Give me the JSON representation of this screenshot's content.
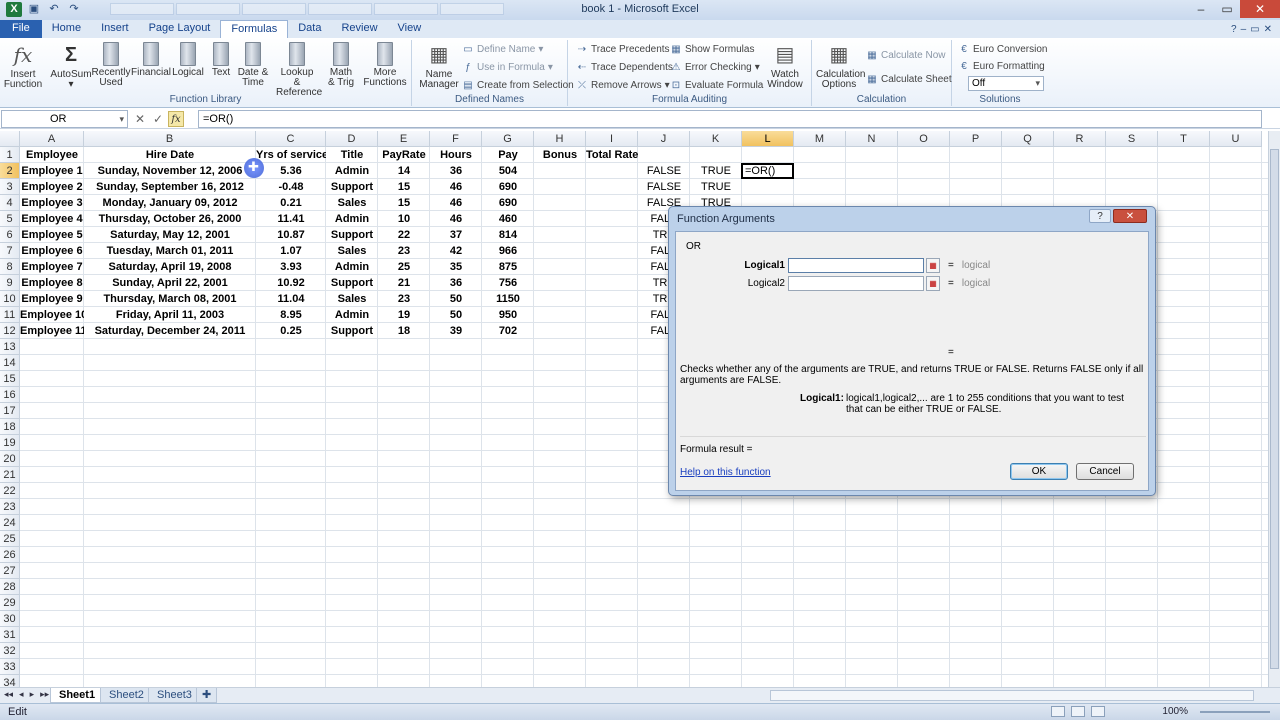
{
  "window": {
    "title": "book 1 - Microsoft Excel",
    "qat_icons": [
      "excel-logo-icon",
      "save-icon",
      "undo-icon",
      "redo-icon"
    ]
  },
  "ribbon_tabs": [
    "File",
    "Home",
    "Insert",
    "Page Layout",
    "Formulas",
    "Data",
    "Review",
    "View"
  ],
  "active_tab": "Formulas",
  "ribbon": {
    "function_library": {
      "label": "Function Library",
      "insert_function": "Insert Function",
      "insert_function_l1": "Insert",
      "insert_function_l2": "Function",
      "autosum": "AutoSum",
      "recently_used_l1": "Recently",
      "recently_used_l2": "Used",
      "financial": "Financial",
      "logical": "Logical",
      "text": "Text",
      "date_time_l1": "Date &",
      "date_time_l2": "Time",
      "lookup_l1": "Lookup &",
      "lookup_l2": "Reference",
      "math_l1": "Math",
      "math_l2": "& Trig",
      "more_l1": "More",
      "more_l2": "Functions"
    },
    "defined_names": {
      "label": "Defined Names",
      "name_manager_l1": "Name",
      "name_manager_l2": "Manager",
      "define_name": "Define Name",
      "use_in_formula": "Use in Formula",
      "create_from_selection": "Create from Selection"
    },
    "formula_auditing": {
      "label": "Formula Auditing",
      "trace_precedents": "Trace Precedents",
      "trace_dependents": "Trace Dependents",
      "remove_arrows": "Remove Arrows",
      "show_formulas": "Show Formulas",
      "error_checking": "Error Checking",
      "evaluate_formula": "Evaluate Formula",
      "watch_window_l1": "Watch",
      "watch_window_l2": "Window"
    },
    "calculation": {
      "label": "Calculation",
      "options_l1": "Calculation",
      "options_l2": "Options",
      "calc_now": "Calculate Now",
      "calc_sheet": "Calculate Sheet"
    },
    "solutions": {
      "label": "Solutions",
      "euro_conversion": "Euro Conversion",
      "euro_formatting": "Euro Formatting",
      "off": "Off"
    }
  },
  "formula_bar": {
    "name_box": "OR",
    "formula": "=OR()"
  },
  "columns": [
    "A",
    "B",
    "C",
    "D",
    "E",
    "F",
    "G",
    "H",
    "I",
    "J",
    "K",
    "L",
    "M",
    "N",
    "O",
    "P",
    "Q",
    "R",
    "S",
    "T",
    "U"
  ],
  "selected_column": "L",
  "selected_row": 2,
  "headers": [
    "Employee",
    "Hire Date",
    "Yrs of service",
    "Title",
    "PayRate",
    "Hours",
    "Pay",
    "Bonus",
    "Total Rate"
  ],
  "rows": [
    [
      "Employee 1",
      "Sunday, November 12, 2006",
      "5.36",
      "Admin",
      "14",
      "36",
      "504"
    ],
    [
      "Employee 2",
      "Sunday, September 16, 2012",
      "-0.48",
      "Support",
      "15",
      "46",
      "690"
    ],
    [
      "Employee 3",
      "Monday, January 09, 2012",
      "0.21",
      "Sales",
      "15",
      "46",
      "690"
    ],
    [
      "Employee 4",
      "Thursday, October 26, 2000",
      "11.41",
      "Admin",
      "10",
      "46",
      "460"
    ],
    [
      "Employee 5",
      "Saturday, May 12, 2001",
      "10.87",
      "Support",
      "22",
      "37",
      "814"
    ],
    [
      "Employee 6",
      "Tuesday, March 01, 2011",
      "1.07",
      "Sales",
      "23",
      "42",
      "966"
    ],
    [
      "Employee 7",
      "Saturday, April 19, 2008",
      "3.93",
      "Admin",
      "25",
      "35",
      "875"
    ],
    [
      "Employee 8",
      "Sunday, April 22, 2001",
      "10.92",
      "Support",
      "21",
      "36",
      "756"
    ],
    [
      "Employee 9",
      "Thursday, March 08, 2001",
      "11.04",
      "Sales",
      "23",
      "50",
      "1150"
    ],
    [
      "Employee 10",
      "Friday, April 11, 2003",
      "8.95",
      "Admin",
      "19",
      "50",
      "950"
    ],
    [
      "Employee 11",
      "Saturday, December 24, 2011",
      "0.25",
      "Support",
      "18",
      "39",
      "702"
    ]
  ],
  "col_j": [
    "FALSE",
    "FALSE",
    "FALSE",
    "FALS",
    "TRU",
    "FALS",
    "FALS",
    "TRU",
    "TRU",
    "FALS",
    "FALS"
  ],
  "col_k": [
    "TRUE",
    "TRUE",
    "TRUE"
  ],
  "active_cell_value": "=OR()",
  "row_numbers": [
    "1",
    "2",
    "3",
    "4",
    "5",
    "6",
    "7",
    "8",
    "9",
    "10",
    "11",
    "12",
    "13",
    "14",
    "15",
    "16",
    "17",
    "18",
    "19",
    "20",
    "21",
    "22",
    "23",
    "24",
    "25",
    "26",
    "27",
    "28",
    "29",
    "30",
    "31",
    "32",
    "33",
    "34"
  ],
  "sheets": [
    "Sheet1",
    "Sheet2",
    "Sheet3"
  ],
  "active_sheet": "Sheet1",
  "status": {
    "mode": "Edit",
    "zoom": "100%"
  },
  "dialog": {
    "title": "Function Arguments",
    "function_name": "OR",
    "arg1_label": "Logical1",
    "arg1_value": "",
    "arg1_result": "logical",
    "arg2_label": "Logical2",
    "arg2_value": "",
    "arg2_result": "logical",
    "eq": "=",
    "description": "Checks whether any of the arguments are TRUE, and returns TRUE or FALSE. Returns FALSE only if all arguments are FALSE.",
    "arg_help_label": "Logical1:",
    "arg_help_text": "logical1,logical2,... are 1 to 255 conditions that you want to test that can be either TRUE or FALSE.",
    "formula_result": "Formula result =",
    "help_link": "Help on this function",
    "ok_label": "OK",
    "cancel_label": "Cancel"
  }
}
